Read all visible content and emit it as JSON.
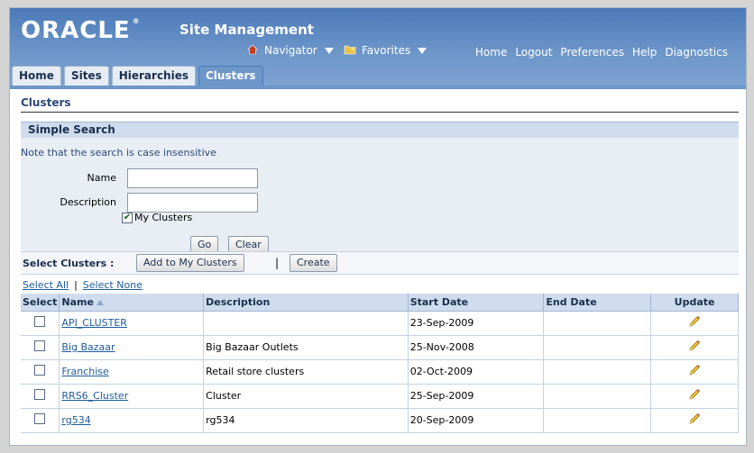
{
  "header": {
    "logo": "ORACLE",
    "app_title": "Site Management",
    "navigator_label": "Navigator",
    "favorites_label": "Favorites",
    "global_links": [
      "Home",
      "Logout",
      "Preferences",
      "Help",
      "Diagnostics"
    ]
  },
  "tabs": [
    {
      "label": "Home",
      "active": false
    },
    {
      "label": "Sites",
      "active": false
    },
    {
      "label": "Hierarchies",
      "active": false
    },
    {
      "label": "Clusters",
      "active": true
    }
  ],
  "page_title": "Clusters",
  "search": {
    "header": "Simple Search",
    "note": "Note that the search is case insensitive",
    "name_label": "Name",
    "name_value": "",
    "description_label": "Description",
    "description_value": "",
    "my_clusters_label": "My Clusters",
    "my_clusters_checked": true,
    "go_label": "Go",
    "clear_label": "Clear"
  },
  "select_bar": {
    "title": "Select Clusters :",
    "add_label": "Add to My Clusters",
    "separator": "|",
    "create_label": "Create"
  },
  "select_links": {
    "select_all": "Select All",
    "select_none": "Select None"
  },
  "table": {
    "columns": [
      "Select",
      "Name",
      "Description",
      "Start Date",
      "End Date",
      "Update"
    ],
    "rows": [
      {
        "name": "API_CLUSTER",
        "description": "",
        "start_date": "23-Sep-2009",
        "end_date": ""
      },
      {
        "name": "Big Bazaar",
        "description": "Big Bazaar Outlets",
        "start_date": "25-Nov-2008",
        "end_date": ""
      },
      {
        "name": "Franchise",
        "description": "Retail store clusters",
        "start_date": "02-Oct-2009",
        "end_date": ""
      },
      {
        "name": "RRS6_Cluster",
        "description": "Cluster",
        "start_date": "25-Sep-2009",
        "end_date": ""
      },
      {
        "name": "rg534",
        "description": "rg534",
        "start_date": "20-Sep-2009",
        "end_date": ""
      }
    ]
  },
  "colors": {
    "header_blue": "#4b7ab8",
    "link_blue": "#1d5c9c",
    "table_header_bg": "#cfdced"
  }
}
